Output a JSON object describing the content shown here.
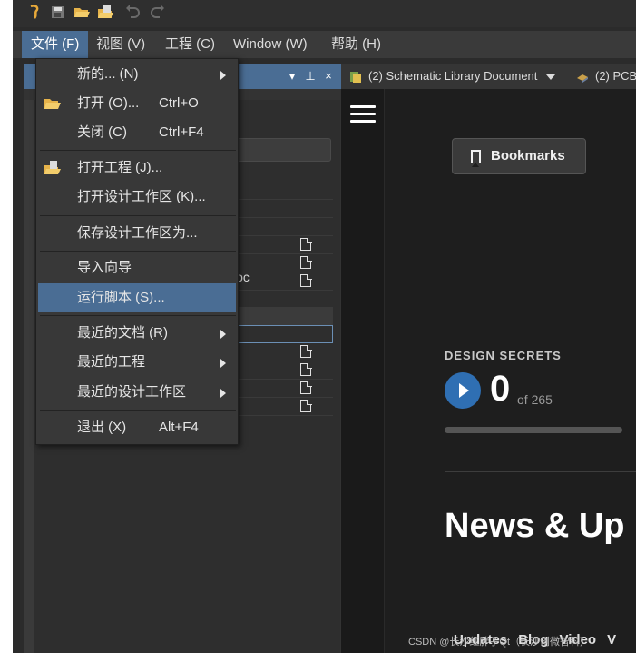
{
  "menubar": {
    "items": [
      {
        "label": "文件 (F)"
      },
      {
        "label": "视图 (V)"
      },
      {
        "label": "工程 (C)"
      },
      {
        "label": "Window (W)"
      },
      {
        "label": "帮助 (H)"
      }
    ]
  },
  "file_menu": {
    "items": [
      {
        "label": "新的... (N)",
        "shortcut": ""
      },
      {
        "label": "打开 (O)...",
        "shortcut": "Ctrl+O"
      },
      {
        "label": "关闭 (C)",
        "shortcut": "Ctrl+F4"
      },
      {
        "label": "打开工程 (J)...",
        "shortcut": ""
      },
      {
        "label": "打开设计工作区 (K)...",
        "shortcut": ""
      },
      {
        "label": "保存设计工作区为...",
        "shortcut": ""
      },
      {
        "label": "导入向导",
        "shortcut": ""
      },
      {
        "label": "运行脚本 (S)...",
        "shortcut": ""
      },
      {
        "label": "最近的文档 (R)",
        "shortcut": ""
      },
      {
        "label": "最近的工程",
        "shortcut": ""
      },
      {
        "label": "最近的设计工作区",
        "shortcut": ""
      },
      {
        "label": "退出 (X)",
        "shortcut": "Alt+F4"
      }
    ]
  },
  "left_panel": {
    "doc_fragment": "Doc",
    "title_buttons": {
      "menu": "▾",
      "pin": "⊥",
      "close": "×"
    }
  },
  "tabs": [
    {
      "label": "(2) Schematic Library Document"
    },
    {
      "label": "(2) PCB"
    }
  ],
  "home": {
    "bookmarks_label": "Bookmarks",
    "design_secrets_label": "DESIGN SECRETS",
    "counter_value": "0",
    "counter_total": "of 265",
    "progress_fraction": 0.0,
    "news_heading": "News & Up",
    "footer_links": [
      "Updates",
      "Blog",
      "Video"
    ],
    "footer_tail": "V"
  },
  "watermark": "CSDN @长沙红胖子Qt（长沙创微智科）",
  "colors": {
    "accent": "#4a6d94",
    "play": "#2f6fb3",
    "background": "#2b2b2b"
  },
  "icons": [
    "app-logo-icon",
    "save-all-icon",
    "open-folder-icon",
    "open-project-icon",
    "undo-icon",
    "redo-icon",
    "hamburger-icon",
    "bookmark-icon",
    "play-icon",
    "document-icon",
    "submenu-arrow-icon"
  ]
}
